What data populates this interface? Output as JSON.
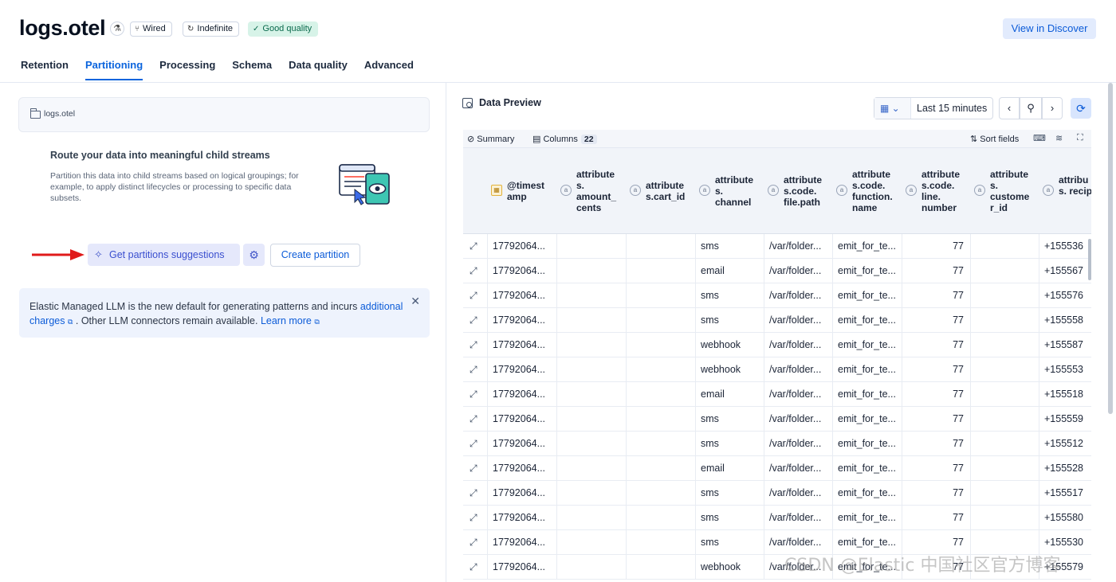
{
  "header": {
    "title": "logs.otel",
    "badges": {
      "wired": "Wired",
      "indefinite": "Indefinite",
      "quality": "Good quality"
    },
    "discover_label": "View in Discover"
  },
  "tabs": [
    {
      "label": "Retention"
    },
    {
      "label": "Partitioning"
    },
    {
      "label": "Processing"
    },
    {
      "label": "Schema"
    },
    {
      "label": "Data quality"
    },
    {
      "label": "Advanced"
    }
  ],
  "left": {
    "stream_name": "logs.otel",
    "route_title": "Route your data into meaningful child streams",
    "route_description": "Partition this data into child streams based on logical groupings; for example, to apply distinct lifecycles or processing to specific data subsets.",
    "suggest_label": "Get partitions suggestions",
    "create_label": "Create partition",
    "callout": {
      "text1": "Elastic Managed LLM is the new default for generating patterns and incurs ",
      "link1": "additional charges",
      "text2": " . Other LLM connectors remain available. ",
      "link2": "Learn more"
    }
  },
  "preview": {
    "title": "Data Preview",
    "time_range": "Last 15 minutes",
    "summary_label": "Summary",
    "columns_label": "Columns",
    "columns_count": "22",
    "sort_label": "Sort fields",
    "columns": [
      {
        "label": "@timest amp",
        "type": "date"
      },
      {
        "label": "attribute s. amount_ cents",
        "type": "string"
      },
      {
        "label": "attribute s.cart_id",
        "type": "string"
      },
      {
        "label": "attribute s. channel",
        "type": "string"
      },
      {
        "label": "attribute s.code. file.path",
        "type": "string"
      },
      {
        "label": "attribute s.code. function. name",
        "type": "string"
      },
      {
        "label": "attribute s.code. line. number",
        "type": "string"
      },
      {
        "label": "attribute s. custome r_id",
        "type": "string"
      },
      {
        "label": "attribu s. recipi",
        "type": "string"
      }
    ],
    "rows": [
      {
        "ts": "17792064...",
        "amount": "",
        "cart": "",
        "channel": "sms",
        "file": "/var/folder...",
        "func": "emit_for_te...",
        "line": "77",
        "customer": "",
        "recipient": "+155536"
      },
      {
        "ts": "17792064...",
        "amount": "",
        "cart": "",
        "channel": "email",
        "file": "/var/folder...",
        "func": "emit_for_te...",
        "line": "77",
        "customer": "",
        "recipient": "+155567"
      },
      {
        "ts": "17792064...",
        "amount": "",
        "cart": "",
        "channel": "sms",
        "file": "/var/folder...",
        "func": "emit_for_te...",
        "line": "77",
        "customer": "",
        "recipient": "+155576"
      },
      {
        "ts": "17792064...",
        "amount": "",
        "cart": "",
        "channel": "sms",
        "file": "/var/folder...",
        "func": "emit_for_te...",
        "line": "77",
        "customer": "",
        "recipient": "+155558"
      },
      {
        "ts": "17792064...",
        "amount": "",
        "cart": "",
        "channel": "webhook",
        "file": "/var/folder...",
        "func": "emit_for_te...",
        "line": "77",
        "customer": "",
        "recipient": "+155587"
      },
      {
        "ts": "17792064...",
        "amount": "",
        "cart": "",
        "channel": "webhook",
        "file": "/var/folder...",
        "func": "emit_for_te...",
        "line": "77",
        "customer": "",
        "recipient": "+155553"
      },
      {
        "ts": "17792064...",
        "amount": "",
        "cart": "",
        "channel": "email",
        "file": "/var/folder...",
        "func": "emit_for_te...",
        "line": "77",
        "customer": "",
        "recipient": "+155518"
      },
      {
        "ts": "17792064...",
        "amount": "",
        "cart": "",
        "channel": "sms",
        "file": "/var/folder...",
        "func": "emit_for_te...",
        "line": "77",
        "customer": "",
        "recipient": "+155559"
      },
      {
        "ts": "17792064...",
        "amount": "",
        "cart": "",
        "channel": "sms",
        "file": "/var/folder...",
        "func": "emit_for_te...",
        "line": "77",
        "customer": "",
        "recipient": "+155512"
      },
      {
        "ts": "17792064...",
        "amount": "",
        "cart": "",
        "channel": "email",
        "file": "/var/folder...",
        "func": "emit_for_te...",
        "line": "77",
        "customer": "",
        "recipient": "+155528"
      },
      {
        "ts": "17792064...",
        "amount": "",
        "cart": "",
        "channel": "sms",
        "file": "/var/folder...",
        "func": "emit_for_te...",
        "line": "77",
        "customer": "",
        "recipient": "+155517"
      },
      {
        "ts": "17792064...",
        "amount": "",
        "cart": "",
        "channel": "sms",
        "file": "/var/folder...",
        "func": "emit_for_te...",
        "line": "77",
        "customer": "",
        "recipient": "+155580"
      },
      {
        "ts": "17792064...",
        "amount": "",
        "cart": "",
        "channel": "sms",
        "file": "/var/folder...",
        "func": "emit_for_te...",
        "line": "77",
        "customer": "",
        "recipient": "+155530"
      },
      {
        "ts": "17792064...",
        "amount": "",
        "cart": "",
        "channel": "webhook",
        "file": "/var/folder...",
        "func": "emit_for_te...",
        "line": "77",
        "customer": "",
        "recipient": "+155579"
      }
    ]
  },
  "watermark": "CSDN @Elastic 中国社区官方博客",
  "colors": {
    "accent": "#0b64dd",
    "success_bg": "#d7f3e8",
    "annotation_arrow": "#e01b1b"
  }
}
